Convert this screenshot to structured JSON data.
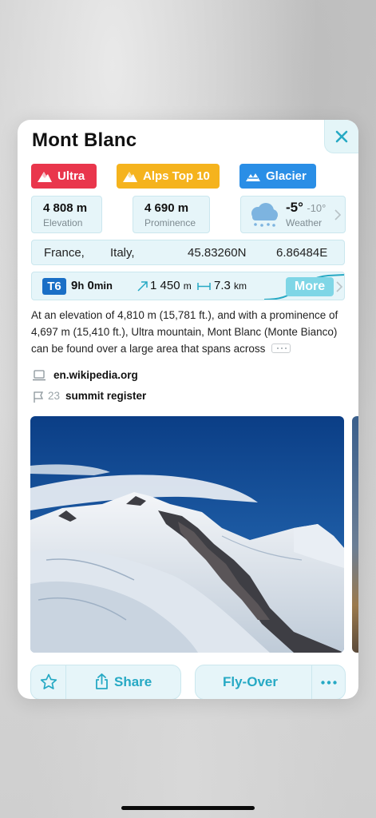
{
  "title": "Mont Blanc",
  "badges": [
    {
      "label": "Ultra",
      "icon": "mountain-icon",
      "color": "#e9364c"
    },
    {
      "label": "Alps Top 10",
      "icon": "mountain-icon",
      "color": "#f5b31d"
    },
    {
      "label": "Glacier",
      "icon": "glacier-icon",
      "color": "#2a8ee6"
    }
  ],
  "stats": {
    "elevation": {
      "value": "4 808",
      "unit": "m",
      "label": "Elevation"
    },
    "prominence": {
      "value": "4 690",
      "unit": "m",
      "label": "Prominence"
    },
    "weather": {
      "temp_high": "-5°",
      "temp_low": "-10°",
      "label": "Weather",
      "icon": "cloud-snow-icon"
    }
  },
  "location": {
    "country1": "France,",
    "country2": "Italy,",
    "lat": "45.83260N",
    "lon": "6.86484E"
  },
  "route": {
    "grade": "T6",
    "hours": "9",
    "hours_unit": "h",
    "minutes": "0",
    "minutes_unit": "min",
    "ascent": "1 450",
    "ascent_unit": "m",
    "distance": "7.3",
    "distance_unit": "km",
    "more_label": "More"
  },
  "description": "At an elevation of 4,810 m (15,781 ft.), and with a prominence of 4,697 m (15,410 ft.), Ultra mountain, Mont Blanc (Monte Bianco) can be found over a large area that spans across",
  "links": {
    "wikipedia": "en.wikipedia.org",
    "summit_count": "23",
    "summit_label": "summit register"
  },
  "actions": {
    "share_label": "Share",
    "flyover_label": "Fly-Over"
  },
  "colors": {
    "accent": "#26a9c4",
    "panel": "#e6f5f9",
    "t6": "#1a6fc6"
  }
}
